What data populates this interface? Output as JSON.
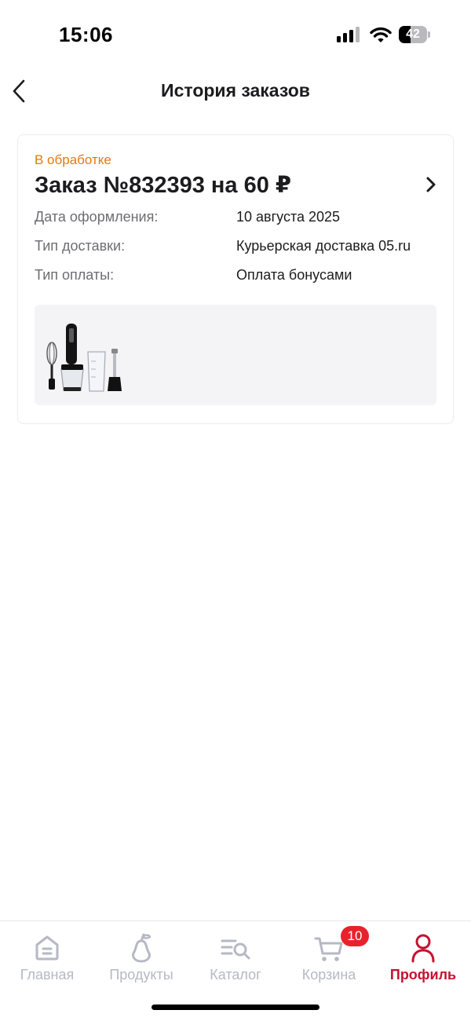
{
  "status_bar": {
    "time": "15:06",
    "battery_level": "42",
    "battery_fraction": 0.42,
    "signal_bars_active": 3,
    "signal_bars_total": 4
  },
  "header": {
    "title": "История заказов",
    "back_icon": "chevron-left-icon"
  },
  "order": {
    "status": "В обработке",
    "status_color": "#e07a10",
    "title": "Заказ №832393 на 60 ₽",
    "chevron_icon": "chevron-right-icon",
    "details": [
      {
        "label": "Дата оформления:",
        "value": "10 августа 2025"
      },
      {
        "label": "Тип доставки:",
        "value": "Курьерская доставка 05.ru"
      },
      {
        "label": "Тип оплаты:",
        "value": "Оплата бонусами"
      }
    ],
    "product_image": "hand-blender-set-image"
  },
  "tab_bar": {
    "active_color": "#c41230",
    "inactive_color": "#b6b8c4",
    "tabs": [
      {
        "label": "Главная",
        "icon": "home-icon"
      },
      {
        "label": "Продукты",
        "icon": "pear-icon"
      },
      {
        "label": "Каталог",
        "icon": "catalog-search-icon"
      },
      {
        "label": "Корзина",
        "icon": "cart-icon",
        "badge": "10"
      },
      {
        "label": "Профиль",
        "icon": "profile-icon",
        "active": true
      }
    ]
  }
}
